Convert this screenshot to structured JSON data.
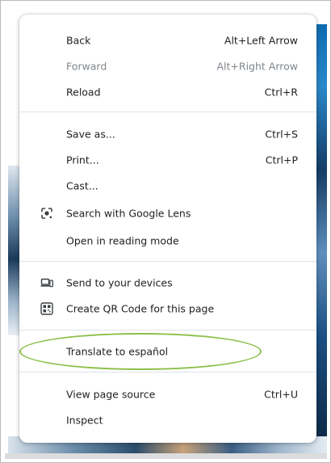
{
  "menu": {
    "items": [
      {
        "label": "Back",
        "shortcut": "Alt+Left Arrow"
      },
      {
        "label": "Forward",
        "shortcut": "Alt+Right Arrow",
        "disabled": true
      },
      {
        "label": "Reload",
        "shortcut": "Ctrl+R"
      },
      {
        "label": "Save as...",
        "shortcut": "Ctrl+S"
      },
      {
        "label": "Print...",
        "shortcut": "Ctrl+P"
      },
      {
        "label": "Cast..."
      },
      {
        "label": "Search with Google Lens",
        "icon": "google-lens-icon"
      },
      {
        "label": "Open in reading mode"
      },
      {
        "label": "Send to your devices",
        "icon": "devices-icon"
      },
      {
        "label": "Create QR Code for this page",
        "icon": "qr-code-icon"
      },
      {
        "label": "Translate to español"
      },
      {
        "label": "View page source",
        "shortcut": "Ctrl+U"
      },
      {
        "label": "Inspect"
      }
    ]
  },
  "colors": {
    "text": "#202124",
    "disabled_text": "#80868b",
    "separator": "#dde3ea",
    "highlight_ellipse": "#8cc04b"
  }
}
